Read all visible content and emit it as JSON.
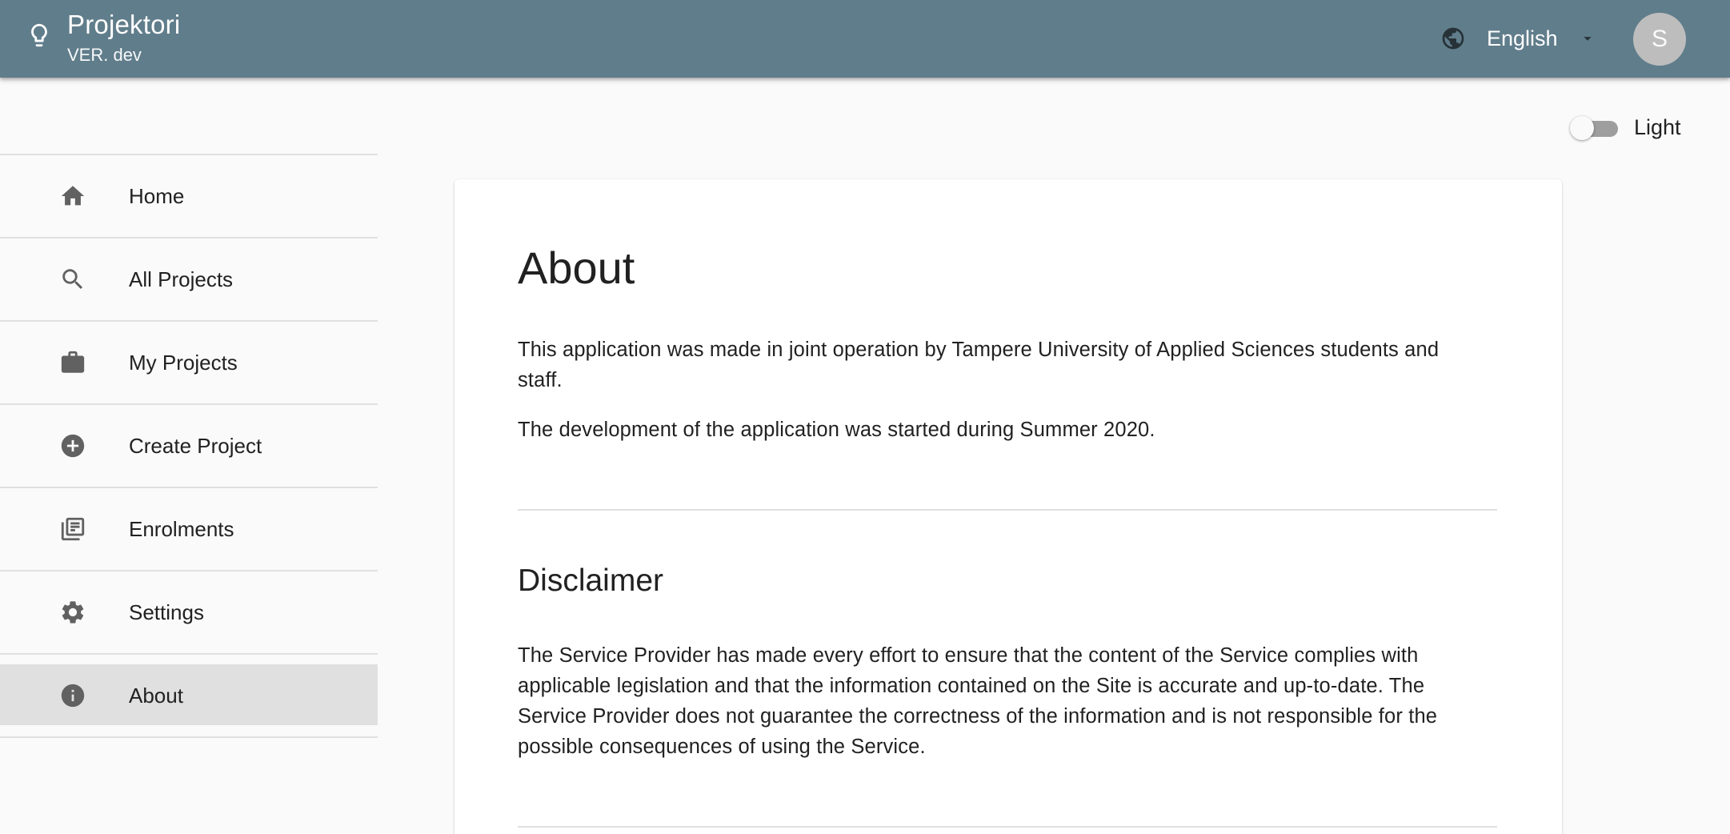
{
  "app": {
    "title": "Projektori",
    "version": "VER. dev"
  },
  "header": {
    "language": "English",
    "avatar_initial": "S",
    "icons": {
      "app": "lightbulb-icon",
      "language": "globe-icon",
      "dropdown": "caret-down-icon"
    }
  },
  "theme": {
    "label": "Light",
    "dark_mode_on": false
  },
  "sidebar": {
    "items": [
      {
        "label": "Home",
        "icon": "home-icon"
      },
      {
        "label": "All Projects",
        "icon": "search-icon"
      },
      {
        "label": "My Projects",
        "icon": "briefcase-icon"
      },
      {
        "label": "Create Project",
        "icon": "add-circle-icon"
      },
      {
        "label": "Enrolments",
        "icon": "library-books-icon"
      },
      {
        "label": "Settings",
        "icon": "gear-icon"
      },
      {
        "label": "About",
        "icon": "info-icon",
        "active": true
      }
    ]
  },
  "main": {
    "title": "About",
    "paragraphs": [
      "This application was made in joint operation by Tampere University of Applied Sciences students and staff.",
      "The development of the application was started during Summer 2020."
    ],
    "disclaimer": {
      "title": "Disclaimer",
      "text": "The Service Provider has made every effort to ensure that the content of the Service complies with applicable legislation and that the information contained on the Site is accurate and up-to-date. The Service Provider does not guarantee the correctness of the information and is not responsible for the possible consequences of using the Service."
    }
  },
  "colors": {
    "appbar": "#607d8b",
    "background": "#fafafa",
    "active_item": "#e0e0e0",
    "icon": "#616161"
  }
}
